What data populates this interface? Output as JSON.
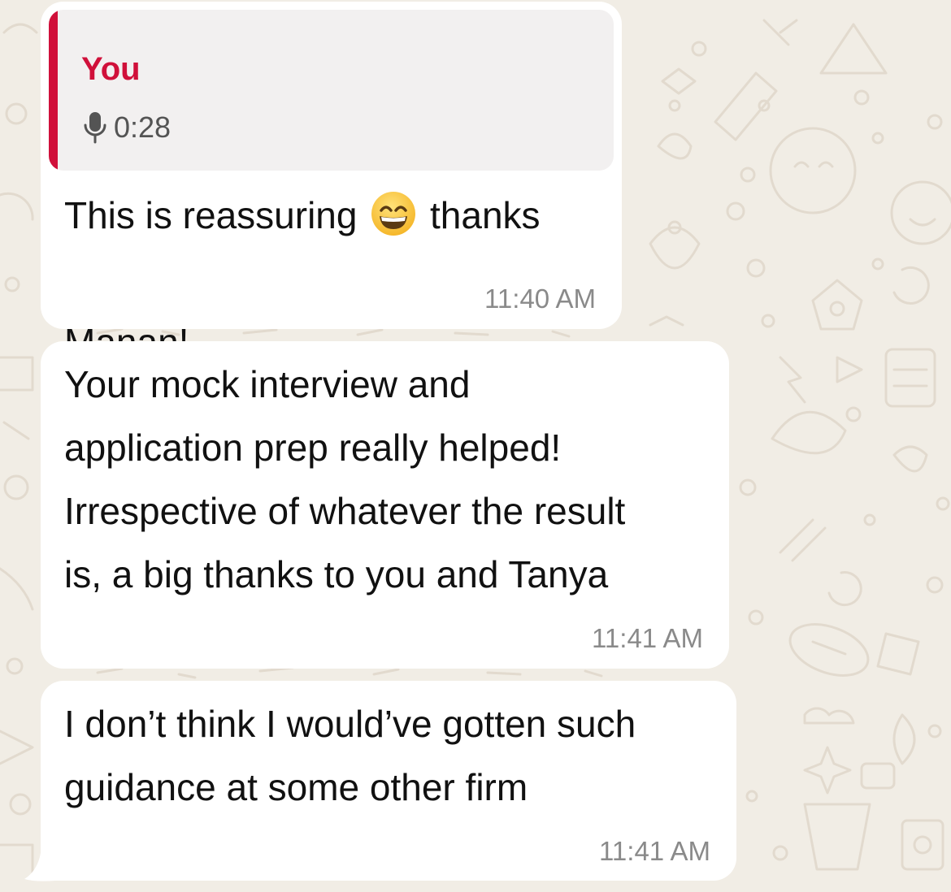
{
  "chat": {
    "messages": [
      {
        "reply_quote": {
          "author": "You",
          "icon": "microphone-icon",
          "duration": "0:28",
          "accent_color": "#d0103a"
        },
        "text_before_emoji": "This is reassuring ",
        "emoji": "grinning-face-with-smiling-eyes",
        "text_after_emoji": " thanks",
        "text_line2": "Manan!",
        "time": "11:40 AM"
      },
      {
        "lines": [
          "Your mock interview and",
          "application prep really helped!",
          "Irrespective of whatever the result",
          "is, a big thanks to you and Tanya"
        ],
        "time": "11:41 AM"
      },
      {
        "lines": [
          "I don’t think I would’ve gotten such",
          "guidance at some other firm"
        ],
        "time": "11:41 AM"
      }
    ]
  },
  "colors": {
    "background": "#f1ede5",
    "bubble": "#ffffff",
    "quote_background": "#f2f0f0",
    "accent": "#d0103a",
    "timestamp": "#8a8a8a"
  }
}
